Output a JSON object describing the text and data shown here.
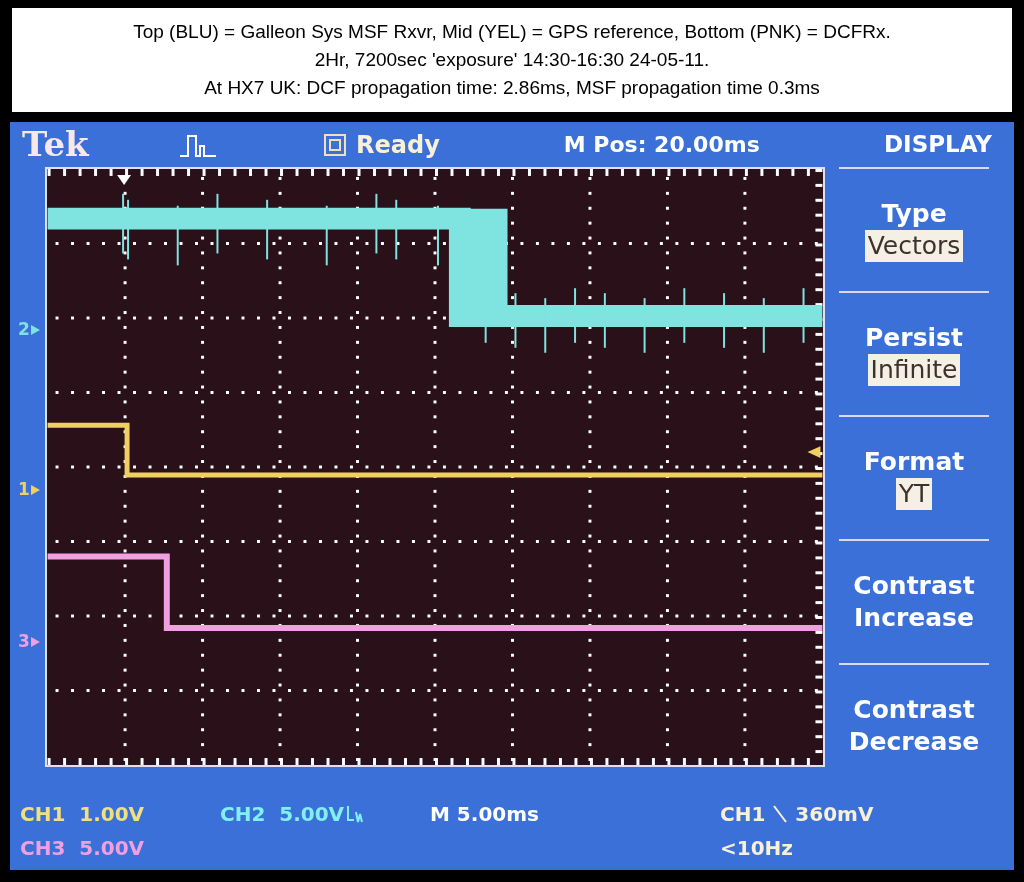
{
  "caption": {
    "lines": [
      "Top (BLU) = Galleon Sys MSF Rxvr, Mid (YEL) = GPS reference, Bottom (PNK) = DCFRx.",
      "2Hr, 7200sec 'exposure' 14:30-16:30 24-05-11.",
      "At HX7 UK: DCF propagation time: 2.86ms, MSF propagation time 0.3ms"
    ]
  },
  "header": {
    "brand": "Tek",
    "status": "Ready",
    "position": "M Pos: 20.00ms"
  },
  "channel_markers": [
    {
      "label": "2",
      "color": "#7fe3e0"
    },
    {
      "label": "1",
      "color": "#f0d060"
    },
    {
      "label": "3",
      "color": "#f0a0e0"
    }
  ],
  "menu": {
    "title": "DISPLAY",
    "items": [
      {
        "kind": "option",
        "label": "Type",
        "value": "Vectors"
      },
      {
        "kind": "option",
        "label": "Persist",
        "value": "Infinite"
      },
      {
        "kind": "option",
        "label": "Format",
        "value": "YT"
      },
      {
        "kind": "action",
        "label": "Contrast Increase"
      },
      {
        "kind": "action",
        "label": "Contrast Decrease"
      }
    ]
  },
  "readouts": [
    {
      "text": "CH1  1.00V",
      "color": "#f0e080",
      "bandwidth_limit": false
    },
    {
      "text": "CH2  5.00V",
      "color": "#80f0f0",
      "bandwidth_limit": true
    },
    {
      "text": "M 5.00ms",
      "color": "#ffffff",
      "bandwidth_limit": false
    },
    {
      "text": "CH3  5.00V",
      "color": "#f0a0e0",
      "bandwidth_limit": false
    }
  ],
  "trigger": {
    "source": "CH1",
    "level": "360mV",
    "frequency": "<10Hz"
  }
}
